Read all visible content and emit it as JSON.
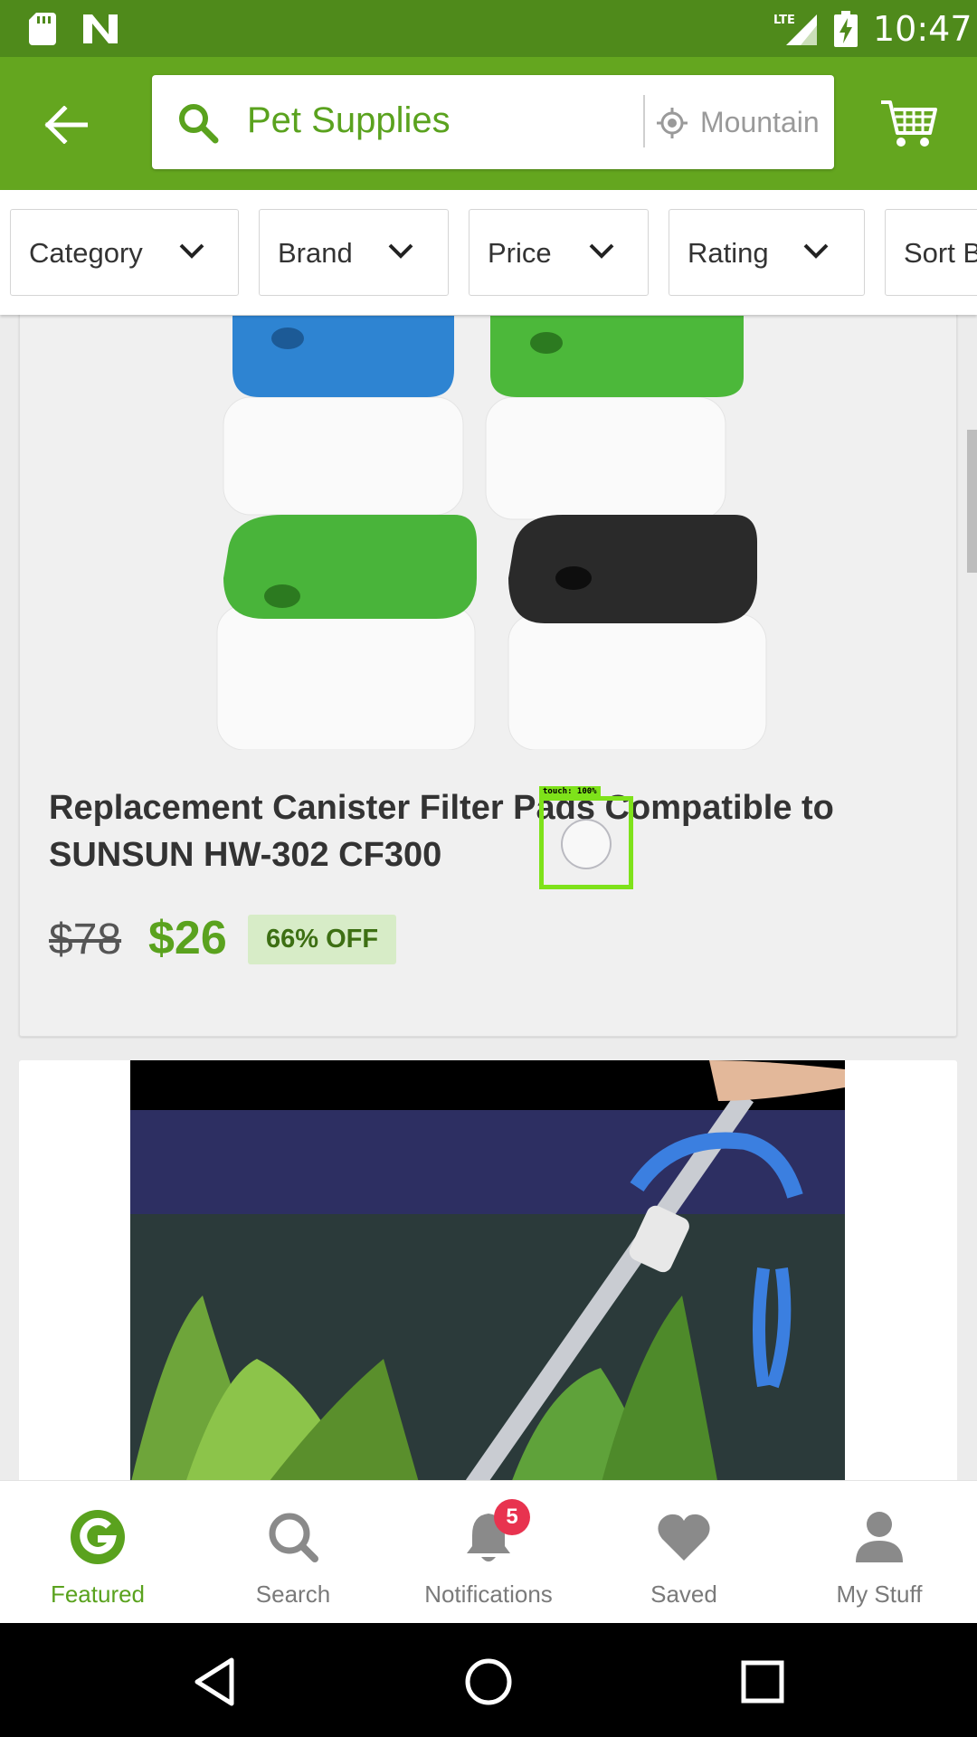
{
  "status_bar": {
    "time": "10:47",
    "network": "LTE"
  },
  "search_bar": {
    "query": "Pet Supplies",
    "location": "Mountain"
  },
  "filters": [
    {
      "label": "Category"
    },
    {
      "label": "Brand"
    },
    {
      "label": "Price"
    },
    {
      "label": "Rating"
    },
    {
      "label": "Sort By"
    }
  ],
  "products": [
    {
      "title": "Replacement Canister Filter Pads Compatible to SUNSUN HW-302 CF300",
      "old_price": "$78",
      "price": "$26",
      "discount": "66% OFF"
    }
  ],
  "touch_overlay": {
    "label": "touch: 100%"
  },
  "bottom_nav": {
    "items": [
      {
        "label": "Featured",
        "icon": "groupon-g-icon",
        "active": true
      },
      {
        "label": "Search",
        "icon": "search-icon"
      },
      {
        "label": "Notifications",
        "icon": "bell-icon"
      },
      {
        "label": "Saved",
        "icon": "heart-icon"
      },
      {
        "label": "My Stuff",
        "icon": "person-icon"
      }
    ],
    "notification_count": "5"
  },
  "colors": {
    "status_bar": "#4f8a1b",
    "app_bar": "#64a61f",
    "accent": "#5aa21e",
    "badge": "#e8334f",
    "touch": "#7ee21a"
  }
}
